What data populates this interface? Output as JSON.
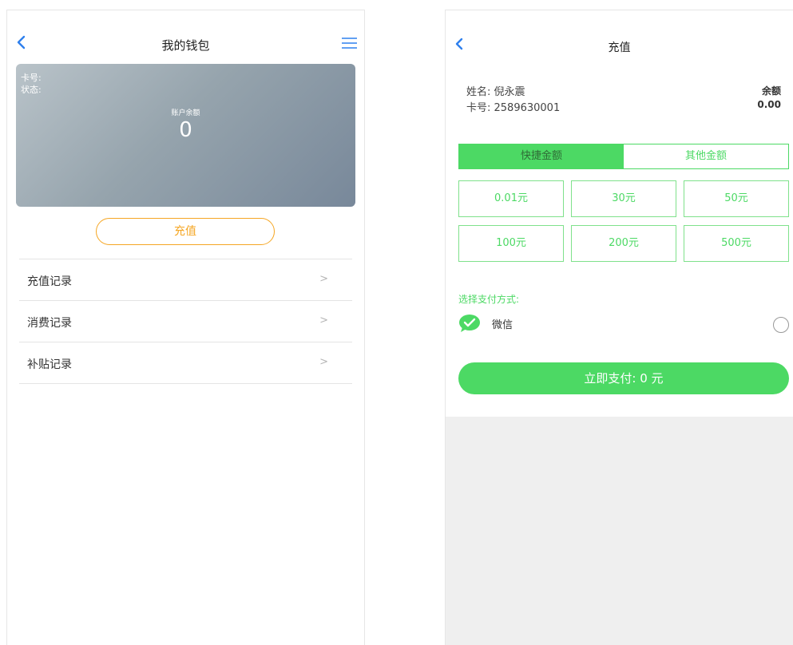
{
  "wallet": {
    "title": "我的钱包",
    "icons": {
      "back": "chevron-left-icon",
      "menu": "hamburger-menu-icon"
    },
    "card": {
      "card_no_label": "卡号:",
      "status_label": "状态:",
      "balance_label": "账户余额",
      "balance_value": "0"
    },
    "recharge_button": "充值",
    "records": [
      {
        "label": "充值记录",
        "chevron": ">"
      },
      {
        "label": "消费记录",
        "chevron": ">"
      },
      {
        "label": "补贴记录",
        "chevron": ">"
      }
    ]
  },
  "recharge": {
    "title": "充值",
    "icons": {
      "back": "chevron-left-icon",
      "wechat": "wechat-icon"
    },
    "user": {
      "name_line": "姓名: 倪永震",
      "card_line": "卡号: 2589630001"
    },
    "balance": {
      "label": "余额",
      "value": "0.00"
    },
    "tabs": [
      {
        "label": "快捷金额",
        "active": true
      },
      {
        "label": "其他金额",
        "active": false
      }
    ],
    "amounts": [
      "0.01元",
      "30元",
      "50元",
      "100元",
      "200元",
      "500元"
    ],
    "pay_method_label": "选择支付方式:",
    "pay_option": "微信",
    "pay_button": "立即支付: 0 元"
  },
  "colors": {
    "accent_blue": "#2f80ed",
    "accent_orange": "#f5a623",
    "accent_green": "#4cd964"
  }
}
